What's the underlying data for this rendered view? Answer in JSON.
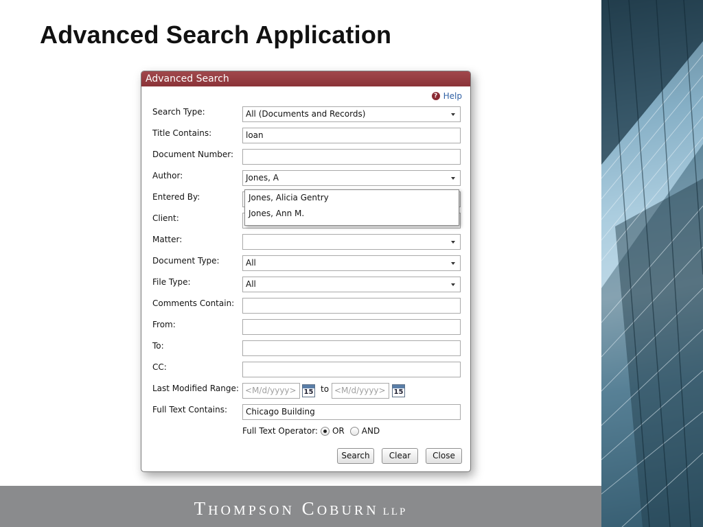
{
  "slide": {
    "title": "Advanced Search Application"
  },
  "dialog": {
    "title": "Advanced Search",
    "help_label": "Help",
    "fields": {
      "search_type": {
        "label": "Search Type:",
        "value": "All (Documents and Records)"
      },
      "title_contains": {
        "label": "Title Contains:",
        "value": "loan"
      },
      "document_number": {
        "label": "Document Number:",
        "value": ""
      },
      "author": {
        "label": "Author:",
        "value": "Jones, A"
      },
      "entered_by": {
        "label": "Entered By:"
      },
      "client": {
        "label": "Client:"
      },
      "matter": {
        "label": "Matter:",
        "value": ""
      },
      "document_type": {
        "label": "Document Type:",
        "value": "All"
      },
      "file_type": {
        "label": "File Type:",
        "value": "All"
      },
      "comments_contain": {
        "label": "Comments Contain:",
        "value": ""
      },
      "from": {
        "label": "From:",
        "value": ""
      },
      "to": {
        "label": "To:",
        "value": ""
      },
      "cc": {
        "label": "CC:",
        "value": ""
      },
      "last_modified_range": {
        "label": "Last Modified Range:",
        "start_placeholder": "<M/d/yyyy>",
        "end_placeholder": "<M/d/yyyy>",
        "to_text": "to",
        "calendar_day": "15"
      },
      "full_text_contains": {
        "label": "Full Text Contains:",
        "value": "Chicago Building"
      }
    },
    "author_suggestions": [
      "Jones, Alicia Gentry",
      "Jones, Ann M."
    ],
    "full_text_operator": {
      "label": "Full Text Operator:",
      "options": [
        "OR",
        "AND"
      ],
      "selected": "OR"
    },
    "buttons": {
      "search": "Search",
      "clear": "Clear",
      "close": "Close"
    }
  },
  "footer": {
    "logo_big_t": "T",
    "logo_hompson": "HOMPSON",
    "logo_big_c": "C",
    "logo_oburn": "OBURN",
    "logo_llp": "LLP",
    "background": "#8a8b8d"
  },
  "colors": {
    "dialog_header": "#96393e",
    "link": "#2e5fa3"
  }
}
